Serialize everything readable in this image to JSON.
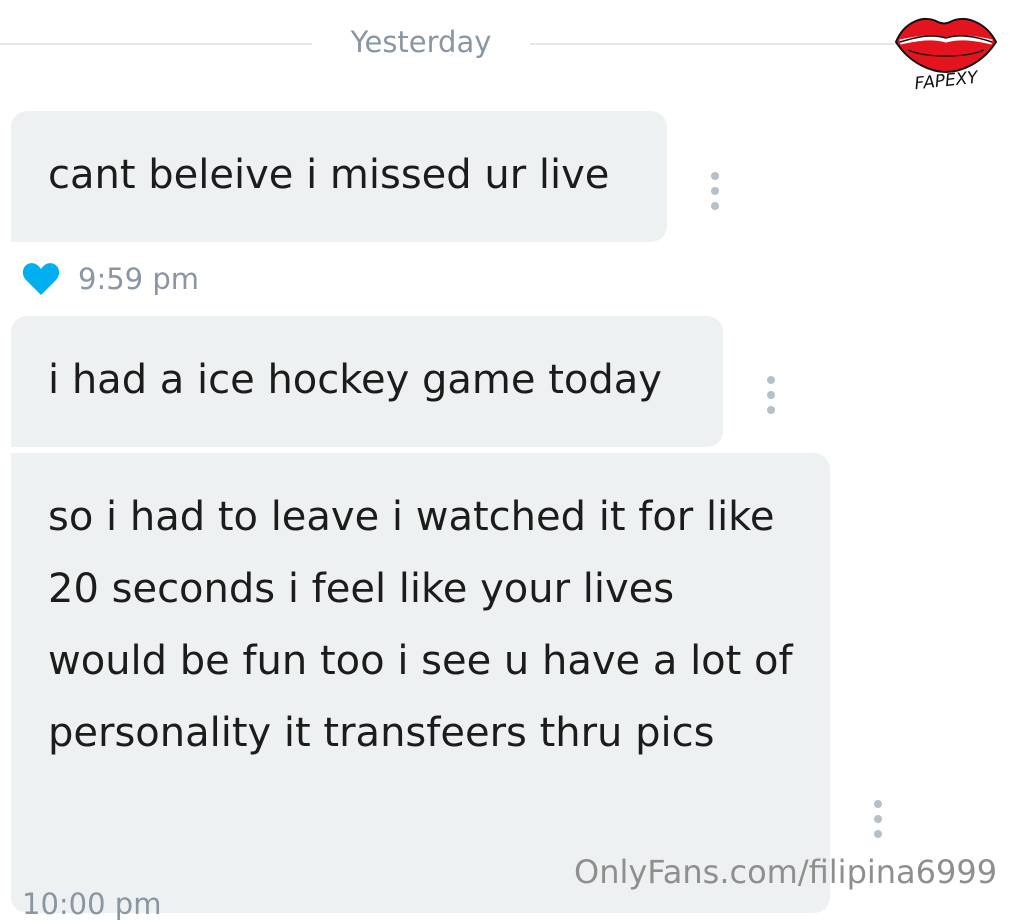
{
  "divider": {
    "label": "Yesterday"
  },
  "messages": [
    {
      "text": "cant beleive i missed ur live",
      "time": "9:59 pm",
      "liked": true
    },
    {
      "text": "i had a ice hockey game today"
    },
    {
      "text": "so i had to leave i watched it for like 20 seconds i feel like your lives would be fun too i see u have a lot of personality it transfeers thru pics",
      "time": "10:00 pm"
    }
  ],
  "watermark": {
    "logo_text": "FAPEXY",
    "url": "OnlyFans.com/filipina6999"
  },
  "colors": {
    "bubble_background": "#eef1f2",
    "meta_text": "#8a96a3",
    "heart": "#00aff0",
    "logo_lips": "#e4141f"
  },
  "icons": {
    "like": "heart-icon",
    "message_menu": "more-vertical-icon"
  }
}
